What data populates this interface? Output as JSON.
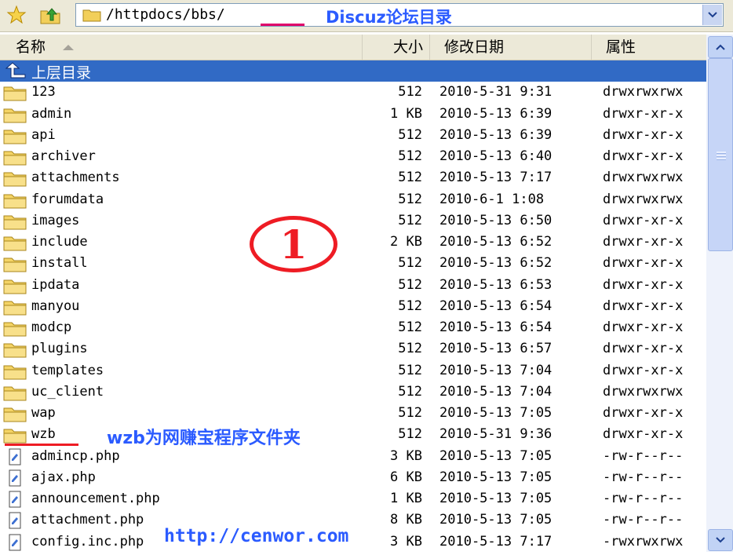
{
  "address": {
    "path": "/httpdocs/bbs/",
    "annotation": "Discuz论坛目录"
  },
  "columns": {
    "name": "名称",
    "size": "大小",
    "modified": "修改日期",
    "attributes": "属性"
  },
  "parent_dir_label": "上层目录",
  "rows": [
    {
      "name": "123",
      "size": "512",
      "date": "2010-5-31 9:31",
      "perm": "drwxrwxrwx",
      "type": "folder"
    },
    {
      "name": "admin",
      "size": "1 KB",
      "date": "2010-5-13 6:39",
      "perm": "drwxr-xr-x",
      "type": "folder"
    },
    {
      "name": "api",
      "size": "512",
      "date": "2010-5-13 6:39",
      "perm": "drwxr-xr-x",
      "type": "folder"
    },
    {
      "name": "archiver",
      "size": "512",
      "date": "2010-5-13 6:40",
      "perm": "drwxr-xr-x",
      "type": "folder"
    },
    {
      "name": "attachments",
      "size": "512",
      "date": "2010-5-13 7:17",
      "perm": "drwxrwxrwx",
      "type": "folder"
    },
    {
      "name": "forumdata",
      "size": "512",
      "date": "2010-6-1 1:08",
      "perm": "drwxrwxrwx",
      "type": "folder"
    },
    {
      "name": "images",
      "size": "512",
      "date": "2010-5-13 6:50",
      "perm": "drwxr-xr-x",
      "type": "folder"
    },
    {
      "name": "include",
      "size": "2 KB",
      "date": "2010-5-13 6:52",
      "perm": "drwxr-xr-x",
      "type": "folder"
    },
    {
      "name": "install",
      "size": "512",
      "date": "2010-5-13 6:52",
      "perm": "drwxr-xr-x",
      "type": "folder"
    },
    {
      "name": "ipdata",
      "size": "512",
      "date": "2010-5-13 6:53",
      "perm": "drwxr-xr-x",
      "type": "folder"
    },
    {
      "name": "manyou",
      "size": "512",
      "date": "2010-5-13 6:54",
      "perm": "drwxr-xr-x",
      "type": "folder"
    },
    {
      "name": "modcp",
      "size": "512",
      "date": "2010-5-13 6:54",
      "perm": "drwxr-xr-x",
      "type": "folder"
    },
    {
      "name": "plugins",
      "size": "512",
      "date": "2010-5-13 6:57",
      "perm": "drwxr-xr-x",
      "type": "folder"
    },
    {
      "name": "templates",
      "size": "512",
      "date": "2010-5-13 7:04",
      "perm": "drwxr-xr-x",
      "type": "folder"
    },
    {
      "name": "uc_client",
      "size": "512",
      "date": "2010-5-13 7:04",
      "perm": "drwxrwxrwx",
      "type": "folder"
    },
    {
      "name": "wap",
      "size": "512",
      "date": "2010-5-13 7:05",
      "perm": "drwxr-xr-x",
      "type": "folder"
    },
    {
      "name": "wzb",
      "size": "512",
      "date": "2010-5-31 9:36",
      "perm": "drwxr-xr-x",
      "type": "folder"
    },
    {
      "name": "admincp.php",
      "size": "3 KB",
      "date": "2010-5-13 7:05",
      "perm": "-rw-r--r--",
      "type": "file"
    },
    {
      "name": "ajax.php",
      "size": "6 KB",
      "date": "2010-5-13 7:05",
      "perm": "-rw-r--r--",
      "type": "file"
    },
    {
      "name": "announcement.php",
      "size": "1 KB",
      "date": "2010-5-13 7:05",
      "perm": "-rw-r--r--",
      "type": "file"
    },
    {
      "name": "attachment.php",
      "size": "8 KB",
      "date": "2010-5-13 7:05",
      "perm": "-rw-r--r--",
      "type": "file"
    },
    {
      "name": "config.inc.php",
      "size": "3 KB",
      "date": "2010-5-13 7:17",
      "perm": "-rwxrwxrwx",
      "type": "file"
    }
  ],
  "annotations": {
    "step_number": "1",
    "wzb_note": "wzb为网赚宝程序文件夹",
    "url": "http://cenwor.com"
  },
  "colors": {
    "selection": "#316ac5",
    "annotation_blue": "#2b5bff",
    "annotation_red": "#ee1c24"
  }
}
